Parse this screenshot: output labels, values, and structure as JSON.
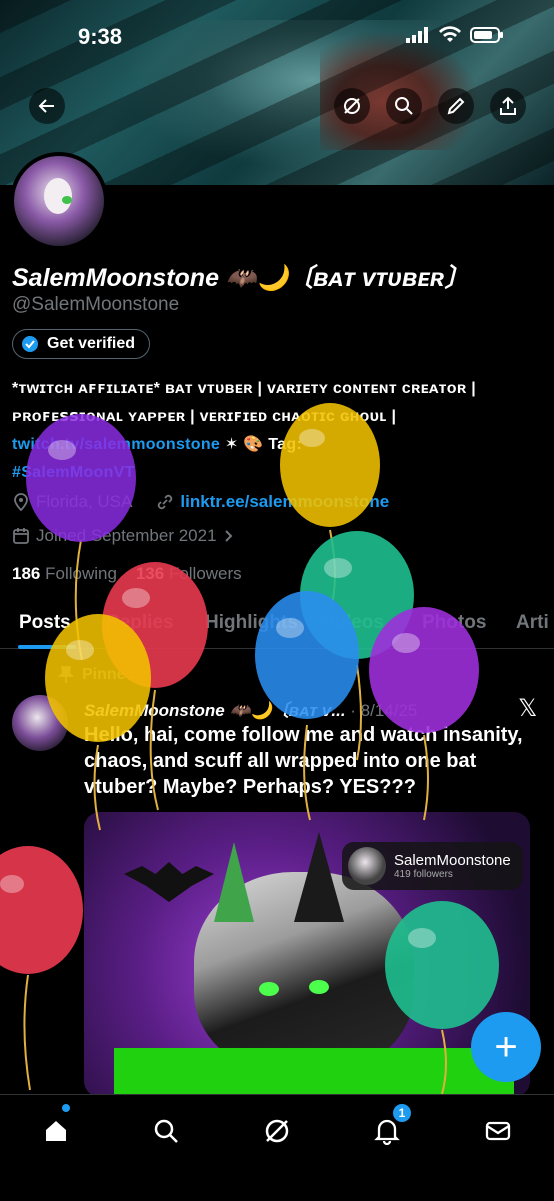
{
  "status_bar": {
    "time": "9:38"
  },
  "profile": {
    "display_name": "SalemMoonstone 🦇🌙〔ʙᴀᴛ ᴠᴛᴜʙᴇʀ〕",
    "handle": "@SalemMoonstone",
    "get_verified_label": "Get verified",
    "bio_text": "*ᴛᴡɪᴛᴄʜ ᴀꜰꜰɪʟɪᴀᴛᴇ* ʙᴀᴛ ᴠᴛᴜʙᴇʀ | ᴠᴀʀɪᴇᴛʏ ᴄᴏɴᴛᴇɴᴛ ᴄʀᴇᴀᴛᴏʀ | ᴘʀᴏꜰᴇꜱꜱɪᴏɴᴀʟ ʏᴀᴘᴘᴇʀ | ᴠᴇʀɪꜰɪᴇᴅ ᴄʜᴀᴏᴛɪᴄ ɢʜᴏᴜʟ | ",
    "bio_link": "twitch.tv/salemmoonstone",
    "bio_tag_text": " ✶ 🎨 Tag:",
    "bio_hashtag": "#SalemMoonVT",
    "location": "Florida, USA",
    "website": "linktr.ee/salemmoonstone",
    "joined": "Joined September 2021",
    "following_count": "186",
    "following_label": "Following",
    "followers_count": "136",
    "followers_label": "Followers"
  },
  "tabs": [
    "Posts",
    "Replies",
    "Highlights",
    "Videos",
    "Photos",
    "Arti"
  ],
  "pinned_post": {
    "pinned_label": "Pinned",
    "author": "SalemMoonstone 🦇🌙〔ʙᴀᴛ ᴠ...",
    "date": "· 8/14/25",
    "text": "Hello, hai, come follow me and watch insanity, chaos, and scuff all wrapped into one bat vtuber? Maybe? Perhaps? YES???",
    "media_chip_name": "SalemMoonstone",
    "media_chip_followers": "419 followers"
  },
  "fab_label": "+",
  "notification_badge": "1",
  "balloon_colors": [
    "#8a2be2",
    "#f2c200",
    "#e8384f",
    "#1fbf8f",
    "#2a8df0",
    "#9d2fd9"
  ]
}
